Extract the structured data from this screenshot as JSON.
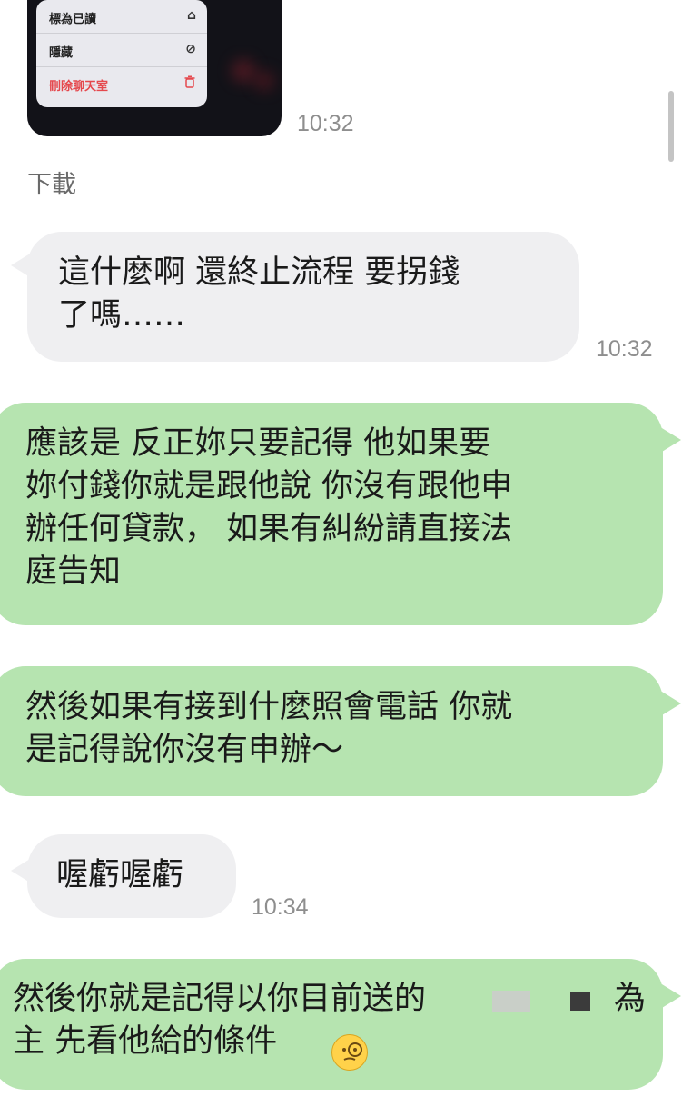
{
  "shared_image": {
    "menu_items": [
      {
        "label": "標為已讀",
        "icon": "mark-read-icon",
        "glyph": "⌂"
      },
      {
        "label": "隱藏",
        "icon": "hide-eye-icon",
        "glyph": "⊘"
      },
      {
        "label": "刪除聊天室",
        "icon": "trash-icon",
        "glyph": "🗑"
      }
    ],
    "time": "10:32",
    "download_label": "下載"
  },
  "messages": [
    {
      "id": "m1",
      "side": "in",
      "text": "這什麼啊 還終止流程 要拐錢\n了嗎……",
      "time": "10:32"
    },
    {
      "id": "m2",
      "side": "out",
      "text": "應該是  反正妳只要記得  他如果要\n妳付錢你就是跟他說  你沒有跟他申\n辦任何貸款，  如果有糾紛請直接法\n庭告知"
    },
    {
      "id": "m3",
      "side": "out",
      "text": "然後如果有接到什麼照會電話  你就\n是記得說你沒有申辦～"
    },
    {
      "id": "m4",
      "side": "in",
      "text": "喔虧喔虧",
      "time": "10:34"
    },
    {
      "id": "m5",
      "side": "out",
      "text_line1_pre": "然後你就是記得以你目前送的",
      "text_line1_post": "為",
      "text_line2": "主 先看他給的條件",
      "emoji": "face-with-monocle-emoji"
    }
  ],
  "colors": {
    "incoming_bubble": "#efeff1",
    "outgoing_bubble": "#b6e4b0",
    "timestamp": "#8e8e8e"
  }
}
